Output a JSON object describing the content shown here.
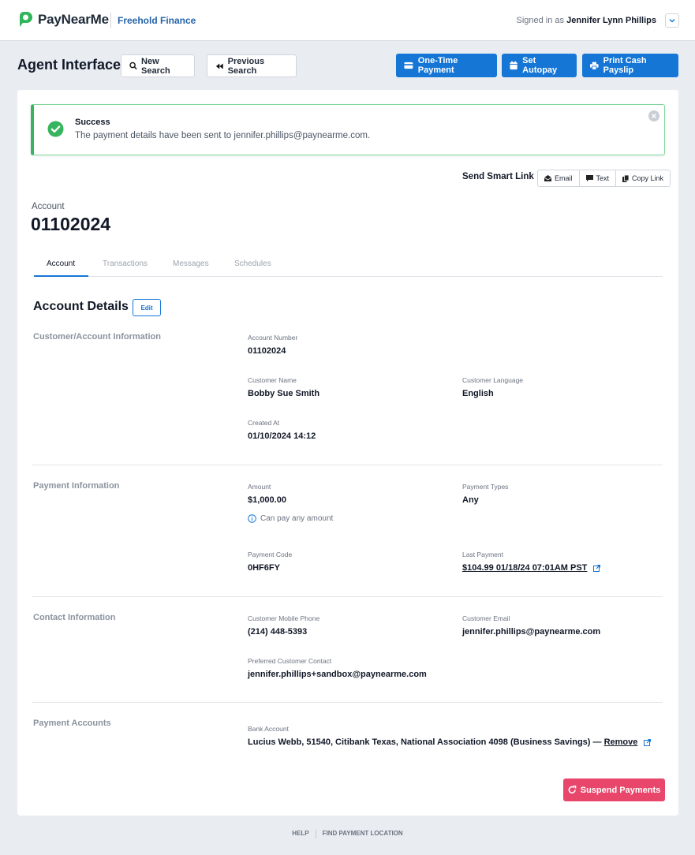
{
  "header": {
    "logo_text": "PayNearMe",
    "org_name": "Freehold Finance",
    "signed_in_prefix": "Signed in as",
    "signed_in_user": "Jennifer Lynn Phillips"
  },
  "toolbar": {
    "page_title": "Agent Interface",
    "new_search": "New Search",
    "previous_search": "Previous Search",
    "one_time_payment": "One-Time Payment",
    "set_autopay": "Set Autopay",
    "print_cash_payslip": "Print Cash Payslip"
  },
  "alert": {
    "title": "Success",
    "message": "The payment details have been sent to jennifer.phillips@paynearme.com."
  },
  "smart_link": {
    "label": "Send Smart Link",
    "email": "Email",
    "text": "Text",
    "copy_link": "Copy Link"
  },
  "account": {
    "label": "Account",
    "number": "01102024"
  },
  "tabs": [
    "Account",
    "Transactions",
    "Messages",
    "Schedules"
  ],
  "details": {
    "title": "Account Details",
    "edit_label": "Edit",
    "customer": {
      "group_title": "Customer/Account Information",
      "account_number_label": "Account Number",
      "account_number": "01102024",
      "customer_name_label": "Customer Name",
      "customer_name": "Bobby Sue Smith",
      "customer_language_label": "Customer Language",
      "customer_language": "English",
      "created_at_label": "Created At",
      "created_at": "01/10/2024 14:12"
    },
    "payment": {
      "group_title": "Payment Information",
      "amount_label": "Amount",
      "amount": "$1,000.00",
      "amount_note": "Can pay any amount",
      "payment_types_label": "Payment Types",
      "payment_types": "Any",
      "payment_code_label": "Payment Code",
      "payment_code": "0HF6FY",
      "last_payment_label": "Last Payment",
      "last_payment": "$104.99 01/18/24 07:01AM PST"
    },
    "contact": {
      "group_title": "Contact Information",
      "mobile_label": "Customer Mobile Phone",
      "mobile": "(214) 448-5393",
      "email_label": "Customer Email",
      "email": "jennifer.phillips@paynearme.com",
      "preferred_label": "Preferred Customer Contact",
      "preferred": "jennifer.phillips+sandbox@paynearme.com"
    },
    "payment_accounts": {
      "group_title": "Payment Accounts",
      "bank_label": "Bank Account",
      "bank_value": "Lucius Webb, 51540, Citibank Texas, National Association 4098 (Business Savings) —",
      "remove_label": "Remove"
    }
  },
  "suspend_label": "Suspend Payments",
  "footer": {
    "help": "HELP",
    "find_location": "FIND PAYMENT LOCATION"
  },
  "colors": {
    "primary": "#1576d6",
    "success": "#36b45e",
    "danger": "#e8476b",
    "brand_green": "#2fb55a"
  }
}
